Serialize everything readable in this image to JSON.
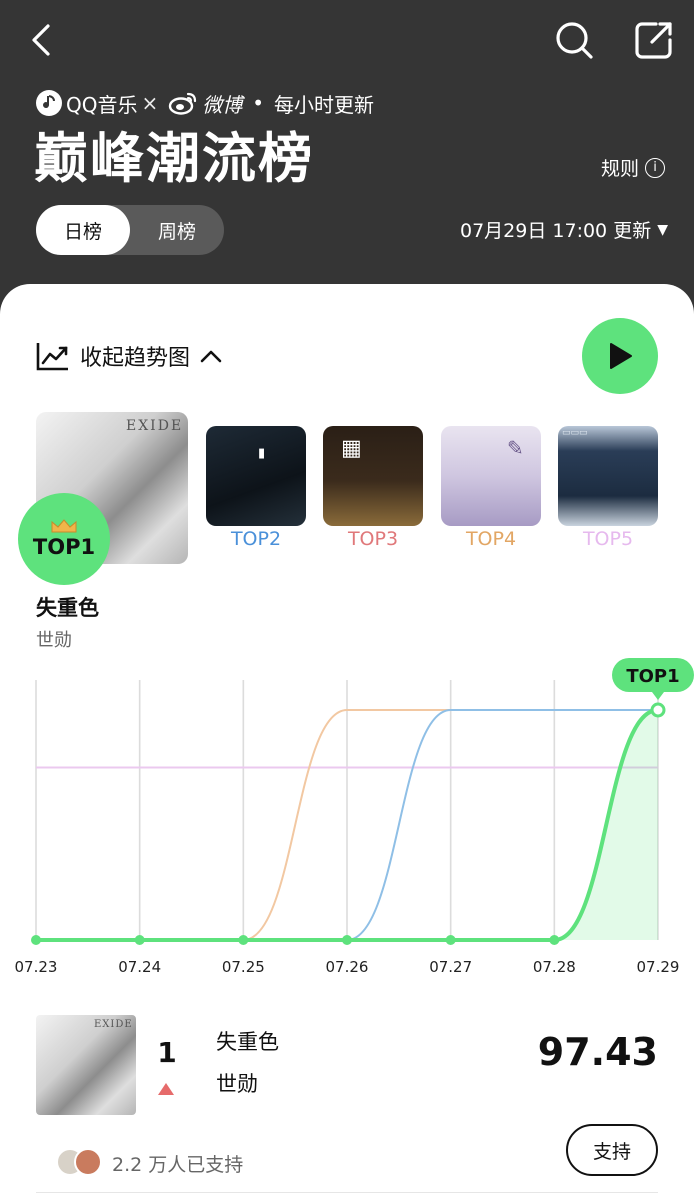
{
  "brand": {
    "qq": "QQ音乐",
    "cross": "×",
    "weibo": "微博",
    "dot": "•",
    "frequency": "每小时更新"
  },
  "header": {
    "title": "巅峰潮流榜",
    "rules": "规则"
  },
  "tabs": [
    {
      "label": "日榜",
      "active": true
    },
    {
      "label": "周榜",
      "active": false
    }
  ],
  "update_time": "07月29日 17:00 更新",
  "trend_toggle": "收起趋势图",
  "top_labels": [
    "TOP2",
    "TOP3",
    "TOP4",
    "TOP5"
  ],
  "top_badge": "TOP1",
  "featured": {
    "title": "失重色",
    "artist": "世勋"
  },
  "chart_data": {
    "type": "line",
    "x": [
      "07.23",
      "07.24",
      "07.25",
      "07.26",
      "07.27",
      "07.28",
      "07.29"
    ],
    "yrank": [
      1,
      5
    ],
    "series": [
      {
        "name": "TOP1",
        "color": "#5ee27d",
        "rank": [
          5,
          5,
          5,
          5,
          5,
          5,
          1
        ]
      },
      {
        "name": "TOP2",
        "color": "#8fbfe6",
        "rank": [
          5,
          5,
          5,
          5,
          1,
          1,
          1
        ]
      },
      {
        "name": "TOP3",
        "color": "#f2c8a2",
        "rank": [
          5,
          5,
          5,
          1,
          1,
          1,
          1
        ]
      },
      {
        "name": "TOP5",
        "color": "#ebc9ef",
        "rank": [
          2,
          2,
          2,
          2,
          2,
          2,
          2
        ]
      }
    ],
    "marker": "TOP1"
  },
  "row": {
    "rank": "1",
    "title": "失重色",
    "artist": "世勋",
    "score": "97.43",
    "supporters": "2.2 万人已支持",
    "support_button": "支持"
  },
  "colors": {
    "accent": "#5ee27d",
    "header_bg": "#353535",
    "top2": "#4a90d9",
    "top3": "#e0787a",
    "top4": "#e2a664",
    "top5": "#e6b9ee",
    "trend_up": "#e66b6b"
  }
}
